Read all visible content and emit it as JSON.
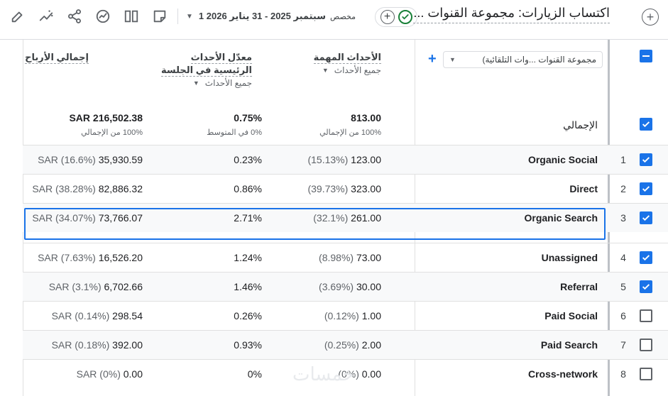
{
  "toolbar": {
    "icons": [
      "pencil-icon",
      "insights-icon",
      "share-icon",
      "compare-icon",
      "columns-icon",
      "note-icon"
    ],
    "date_custom": "مخصص",
    "date_range": "1 سبتمبر 2025 - 31 يناير 2026",
    "pill_plus": "+",
    "report_title": "اكتساب الزيارات: مجموعة القنوات ...",
    "add_report": "+"
  },
  "table": {
    "dimension_dropdown": "مجموعة القنوات ...وات التلقائية)",
    "add_dimension": "+",
    "columns": [
      {
        "label": "الأحداث المهمة",
        "sub": "جميع الأحداث"
      },
      {
        "label_line1": "معدّل الأحداث",
        "label_line2": "الرئيسية في الجلسة",
        "sub": "جميع الأحداث"
      },
      {
        "label": "إجمالي الأرباح"
      }
    ],
    "totals": {
      "label": "الإجمالي",
      "key_events": "813.00",
      "key_events_sub": "100% من الإجمالي",
      "rate": "0.75%",
      "rate_sub": "0% في المتوسط",
      "revenue": "SAR 216,502.38",
      "revenue_sub": "100% من الإجمالي"
    },
    "rows": [
      {
        "num": "1",
        "name": "Organic Social",
        "checked": true,
        "events": "123.00",
        "events_pct": "(15.13%)",
        "rate": "0.23%",
        "rev_pct": "(16.6%)",
        "revenue": "35,930.59"
      },
      {
        "num": "2",
        "name": "Direct",
        "checked": true,
        "events": "323.00",
        "events_pct": "(39.73%)",
        "rate": "0.86%",
        "rev_pct": "(38.28%)",
        "revenue": "82,886.32"
      },
      {
        "num": "3",
        "name": "Organic Search",
        "checked": true,
        "events": "261.00",
        "events_pct": "(32.1%)",
        "rate": "2.71%",
        "rev_pct": "(34.07%)",
        "revenue": "73,766.07"
      },
      {
        "num": "4",
        "name": "Unassigned",
        "checked": true,
        "events": "73.00",
        "events_pct": "(8.98%)",
        "rate": "1.24%",
        "rev_pct": "(7.63%)",
        "revenue": "16,526.20"
      },
      {
        "num": "5",
        "name": "Referral",
        "checked": true,
        "events": "30.00",
        "events_pct": "(3.69%)",
        "rate": "1.46%",
        "rev_pct": "(3.1%)",
        "revenue": "6,702.66"
      },
      {
        "num": "6",
        "name": "Paid Social",
        "checked": false,
        "events": "1.00",
        "events_pct": "(0.12%)",
        "rate": "0.26%",
        "rev_pct": "(0.14%)",
        "revenue": "298.54"
      },
      {
        "num": "7",
        "name": "Paid Search",
        "checked": false,
        "events": "2.00",
        "events_pct": "(0.25%)",
        "rate": "0.93%",
        "rev_pct": "(0.18%)",
        "revenue": "392.00"
      },
      {
        "num": "8",
        "name": "Cross-network",
        "checked": false,
        "events": "0.00",
        "events_pct": "(0%)",
        "rate": "0%",
        "rev_pct": "(0%)",
        "revenue": "0.00"
      }
    ],
    "currency": "SAR"
  },
  "watermark": "خمسات",
  "colors": {
    "accent": "#1a73e8",
    "success": "#188038"
  }
}
